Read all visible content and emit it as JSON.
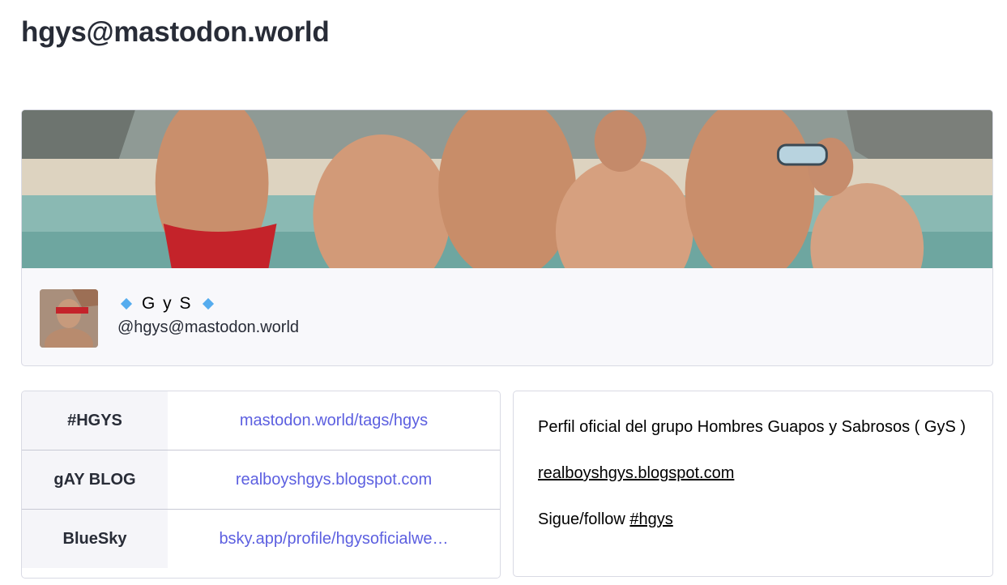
{
  "page": {
    "title": "hgys@mastodon.world"
  },
  "profile": {
    "banner_alt": "header-image",
    "display_name": "G y S",
    "name_decoration": "diamond-icon",
    "handle": "@hgys@mastodon.world",
    "accent_color": "#55acee"
  },
  "fields": [
    {
      "name": "#HGYS",
      "value": "mastodon.world/tags/hgys"
    },
    {
      "name": "gAY BLOG",
      "value": "realboyshgys.blogspot.com"
    },
    {
      "name": "BlueSky",
      "value": "bsky.app/profile/hgysoficialwe…"
    }
  ],
  "bio": {
    "line1": "Perfil oficial del grupo Hombres Guapos y Sabrosos ( GyS )",
    "link": "realboyshgys.blogspot.com",
    "follow_prefix": "Sigue/follow ",
    "hashtag": "#hgys"
  },
  "colors": {
    "link": "#5c5fe0",
    "border": "#d9dae4",
    "field_bg": "#f5f5f9"
  }
}
